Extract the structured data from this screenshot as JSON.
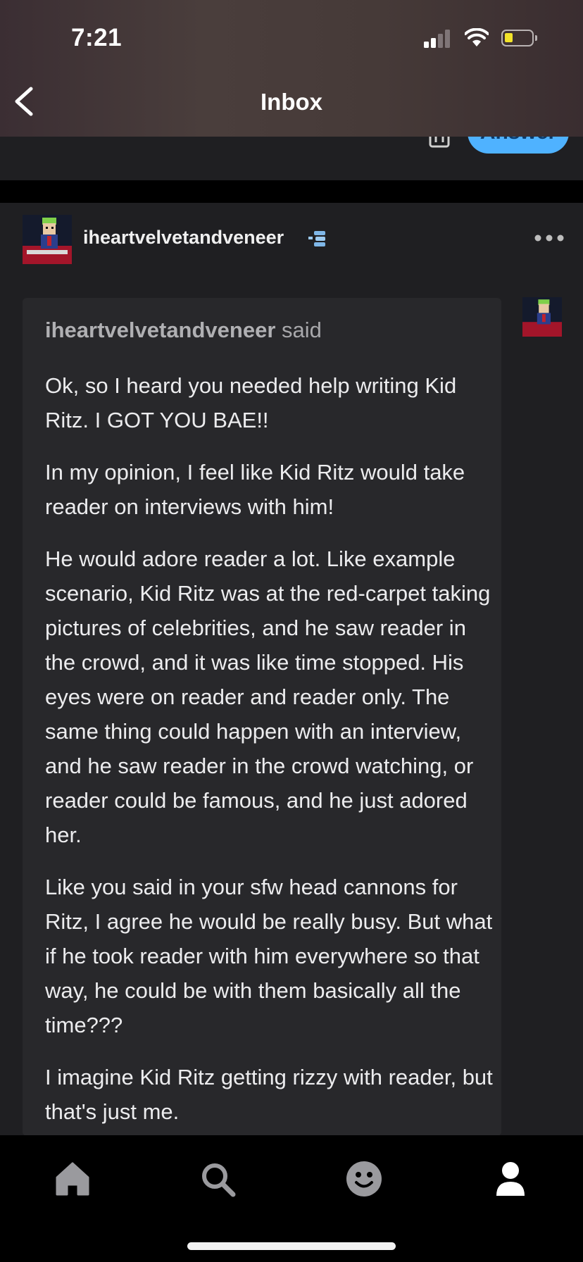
{
  "status_bar": {
    "time": "7:21"
  },
  "header": {
    "title": "Inbox"
  },
  "previous_post": {
    "answer_label": "Answer"
  },
  "post": {
    "username": "iheartvelvetandveneer",
    "ask": {
      "asker": "iheartvelvetandveneer",
      "said_label": " said",
      "paragraphs": [
        "Ok, so I heard you needed help writing Kid Ritz. I GOT YOU BAE!!",
        "In my opinion, I feel like Kid Ritz would take reader on interviews with him!",
        "He would adore reader a lot. Like example scenario, Kid Ritz was at the red-carpet taking pictures of celebrities, and he saw reader in the crowd, and it was like time stopped. His eyes were on reader and reader only. The same thing could happen with an interview, and he saw reader in the crowd watching, or reader could be famous, and he just adored her.",
        "Like you said in your sfw head cannons for Ritz, I agree he would be really busy. But what if he took reader with him everywhere so that way, he could be with them basically all the time???",
        "I imagine Kid Ritz getting rizzy with reader, but that's just me."
      ]
    }
  },
  "tabbar": {
    "items": [
      "home-icon",
      "search-icon",
      "activity-icon",
      "account-icon"
    ]
  },
  "colors": {
    "answer_button": "#4fb2ff",
    "background": "#1f1f22",
    "ask_box": "#28282b"
  }
}
